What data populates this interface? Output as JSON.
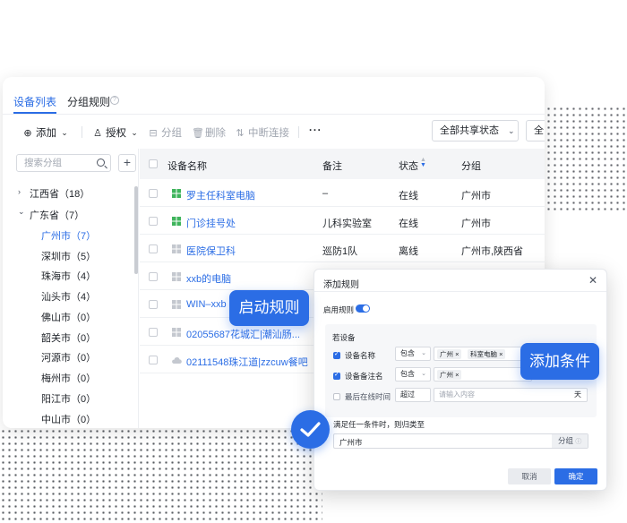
{
  "tabs": [
    {
      "label": "设备列表",
      "active": true
    },
    {
      "label": "分组规则",
      "active": false
    }
  ],
  "toolbar": {
    "add": "添加",
    "authorize": "授权",
    "group": "分组",
    "delete": "删除",
    "disconnect": "中断连接",
    "more": "···",
    "share_filter": "全部共享状态",
    "second_filter": "全"
  },
  "sidebar": {
    "search_placeholder": "搜索分组",
    "add_button": "+",
    "tree": [
      {
        "label": "江西省（18）",
        "expanded": false,
        "level": 0
      },
      {
        "label": "广东省（7）",
        "expanded": true,
        "level": 0
      },
      {
        "label": "广州市（7）",
        "level": 1,
        "selected": true
      },
      {
        "label": "深圳市（5）",
        "level": 1
      },
      {
        "label": "珠海市（4）",
        "level": 1
      },
      {
        "label": "汕头市（4）",
        "level": 1
      },
      {
        "label": "佛山市（0）",
        "level": 1
      },
      {
        "label": "韶关市（0）",
        "level": 1
      },
      {
        "label": "河源市（0）",
        "level": 1
      },
      {
        "label": "梅州市（0）",
        "level": 1
      },
      {
        "label": "阳江市（0）",
        "level": 1
      },
      {
        "label": "中山市（0）",
        "level": 1
      }
    ]
  },
  "table": {
    "columns": [
      "设备名称",
      "备注",
      "状态",
      "分组"
    ],
    "rows": [
      {
        "name": "罗主任科室电脑",
        "note": "–",
        "status": "在线",
        "group": "广州市",
        "icon": "windows-icon"
      },
      {
        "name": "门诊挂号处",
        "note": "儿科实验室",
        "status": "在线",
        "group": "广州市",
        "icon": "windows-icon"
      },
      {
        "name": "医院保卫科",
        "note": "巡防1队",
        "status": "离线",
        "group": "广州市,陕西省",
        "icon": "windows-icon"
      },
      {
        "name": "xxb的电脑",
        "note": "",
        "status": "",
        "group": "",
        "icon": "windows-icon"
      },
      {
        "name": "WIN–xxb",
        "note": "",
        "status": "",
        "group": "",
        "icon": "windows-icon"
      },
      {
        "name": "02055687花城汇|潮汕肠...",
        "note": "",
        "status": "",
        "group": "",
        "icon": "windows-icon"
      },
      {
        "name": "02111548珠江道|zzcuw餐吧",
        "note": "",
        "status": "",
        "group": "",
        "icon": "cloud-icon"
      }
    ]
  },
  "dialog": {
    "title": "添加规则",
    "close": "✕",
    "enable_label": "启用规则",
    "enabled": true,
    "if_device": "若设备",
    "conditions": [
      {
        "label": "设备名称",
        "checked": true,
        "operator": "包含",
        "tags": [
          "广州",
          "科室电脑"
        ]
      },
      {
        "label": "设备备注名",
        "checked": true,
        "operator": "包含",
        "tags": [
          "广州"
        ]
      },
      {
        "label": "最后在线时间",
        "checked": false,
        "operator": "超过",
        "placeholder": "请输入内容",
        "unit": "天"
      }
    ],
    "result_label": "满足任一条件时，则归类至",
    "result_value": "广州市",
    "result_suffix": "分组",
    "cancel": "取消",
    "confirm": "确定"
  },
  "callouts": {
    "start_rule": "启动规则",
    "add_condition": "添加条件"
  },
  "colors": {
    "primary": "#2b6de5",
    "windows_icon": "#3fb45c",
    "text": "#1f2329"
  }
}
